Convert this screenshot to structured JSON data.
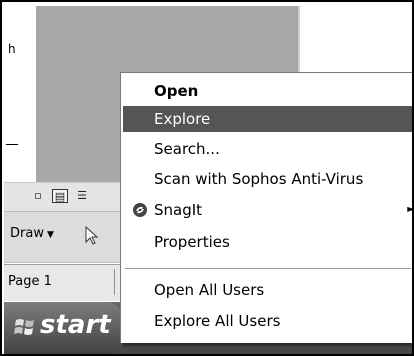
{
  "document": {
    "text_fragment": "h"
  },
  "view_buttons": [
    {
      "icon": "normal-view-icon",
      "glyph": "▫"
    },
    {
      "icon": "slide-sorter-icon",
      "glyph": "▤"
    },
    {
      "icon": "outline-view-icon",
      "glyph": "☰"
    }
  ],
  "drawing_toolbar": {
    "draw_label": "Draw",
    "draw_caret": "▼"
  },
  "status_bar": {
    "page_label": "Page 1"
  },
  "taskbar": {
    "start_label": "start"
  },
  "context_menu": {
    "items": [
      {
        "label": "Open",
        "bold": true
      },
      {
        "label": "Explore",
        "highlighted": true
      },
      {
        "label": "Search..."
      },
      {
        "label": "Scan with Sophos Anti-Virus"
      },
      {
        "label": "SnagIt",
        "icon": "snagit-icon",
        "submenu": true
      },
      {
        "label": "Properties"
      },
      {
        "label": "Open All Users"
      },
      {
        "label": "Explore All Users"
      }
    ],
    "submenu_arrow": "►"
  },
  "colors": {
    "highlight": "#555555",
    "taskbar": "#4a4a4a",
    "gray_pane": "#a8a8a8"
  }
}
